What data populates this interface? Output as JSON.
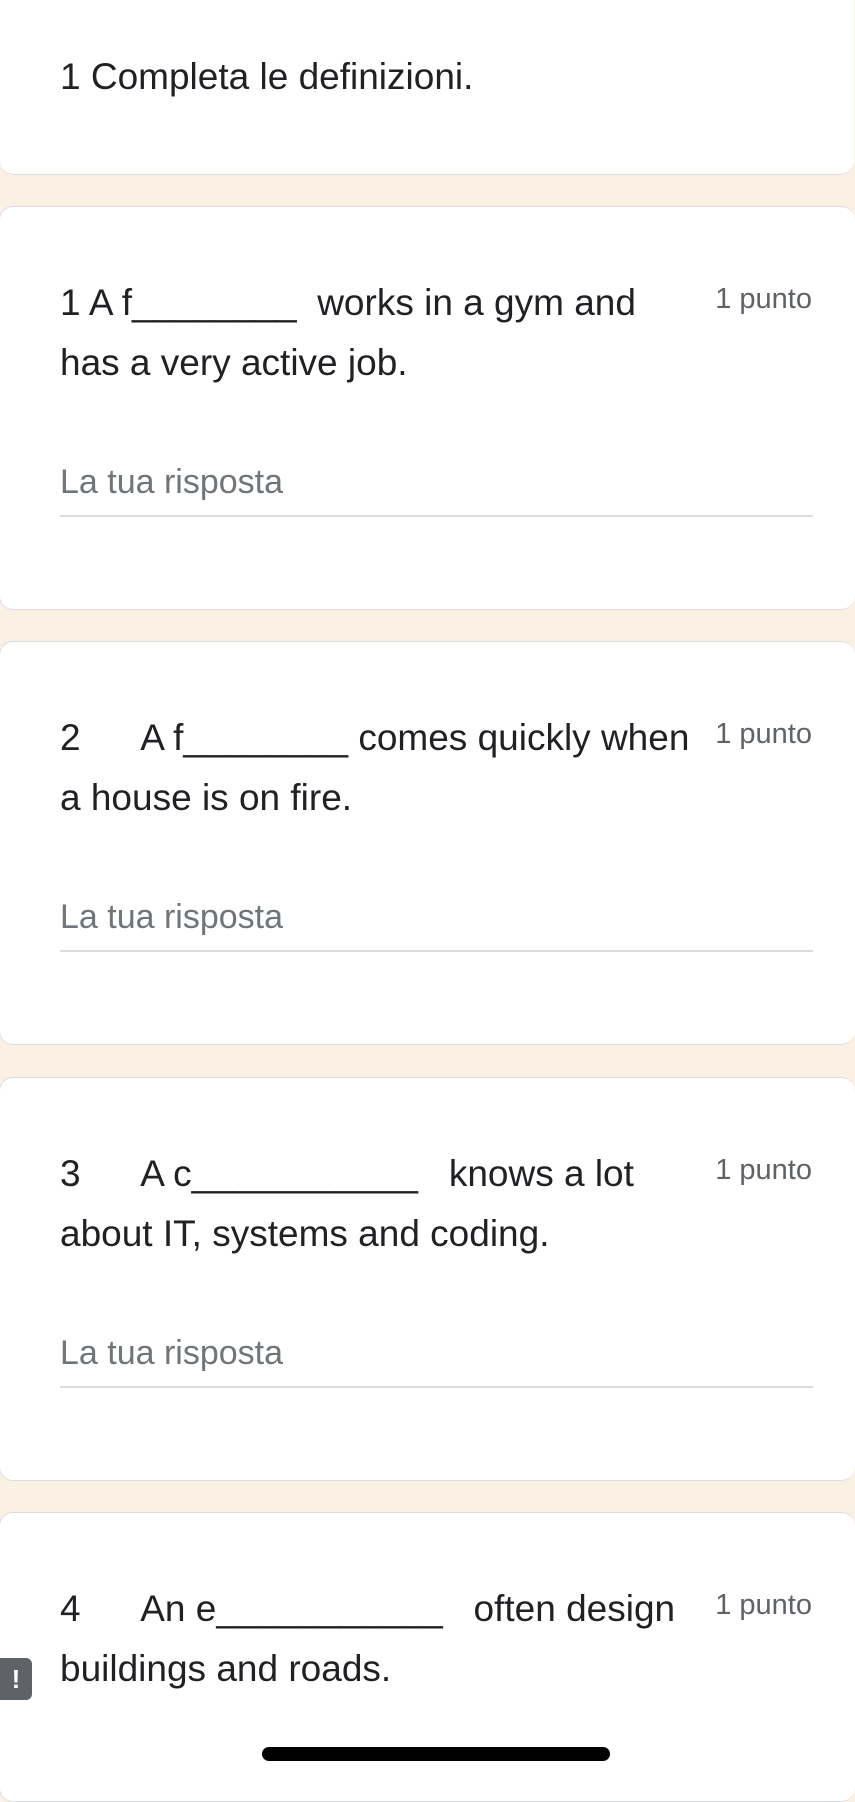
{
  "section": {
    "title": "1 Completa le definizioni."
  },
  "questions": [
    {
      "text": "1 A f________  works in a gym and has a very active job.",
      "points": "1 punto",
      "placeholder": "La tua risposta"
    },
    {
      "text": "2      A f________ comes quickly when a house is on fire.",
      "points": "1 punto",
      "placeholder": "La tua risposta"
    },
    {
      "text": "3      A c___________   knows a lot about IT, systems and coding.",
      "points": "1 punto",
      "placeholder": "La tua risposta"
    },
    {
      "text": "4      An e___________   often design buildings and roads.",
      "points": "1 punto",
      "placeholder": ""
    }
  ],
  "error_badge": "!",
  "colors": {
    "background": "#fbf0e4",
    "card": "#ffffff",
    "border": "#dadce0",
    "placeholder": "#70757a"
  }
}
